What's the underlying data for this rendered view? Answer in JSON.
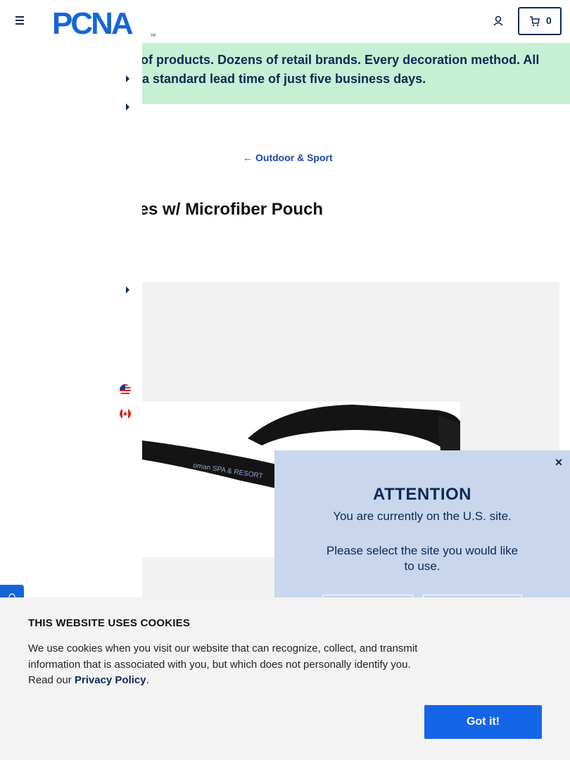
{
  "header": {
    "logo_text": "PCNA",
    "logo_tm": "TM",
    "menu_icon": "hamburger-icon",
    "account_icon": "user-icon",
    "cart_icon": "cart-icon",
    "cart_count": "0"
  },
  "banner": {
    "line1": "ls of products. Dozens of retail brands. Every decoration method. All",
    "line2": "th a standard lead time of just five business days."
  },
  "sidenav": {
    "flags": [
      "us-flag-icon",
      "canada-flag-icon"
    ]
  },
  "breadcrumb": {
    "arrow": "←",
    "label": "Outdoor & Sport"
  },
  "product": {
    "title": "sses w/ Microfiber Pouch",
    "imprint_text": "oman SPA & RESORT"
  },
  "modal": {
    "close": "×",
    "heading": "ATTENTION",
    "line1": "You are currently on the U.S. site.",
    "line2": "Please select the site you would like to use."
  },
  "cookie": {
    "title": "THIS WEBSITE USES COOKIES",
    "text_before": "We use cookies when you visit our website that can recognize, collect, and transmit information that is associated with you, but which does not personally identify you. Read our ",
    "link": "Privacy Policy",
    "text_after": ".",
    "button": "Got it!"
  },
  "colors": {
    "brand_navy": "#0b2a56",
    "banner_green": "#c6efd4",
    "modal_blue": "#c9d6ec",
    "cta_blue": "#1565e8"
  }
}
